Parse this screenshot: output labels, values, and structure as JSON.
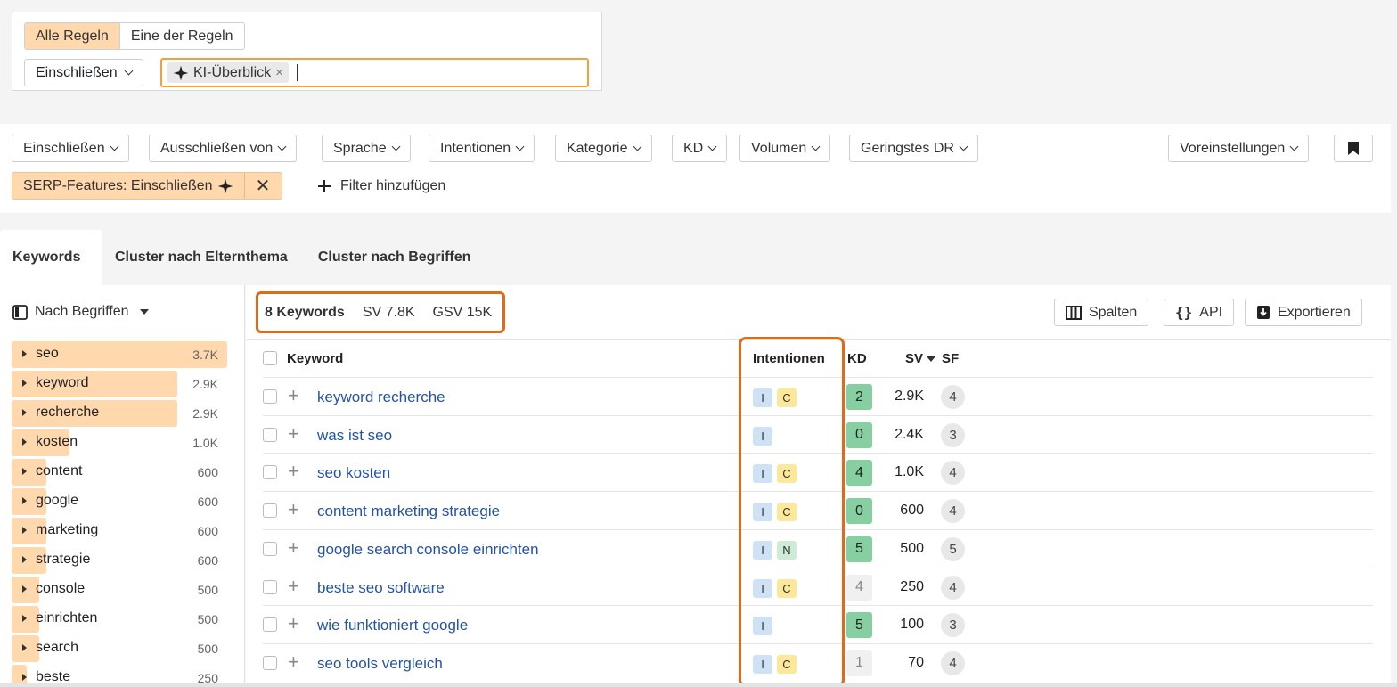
{
  "rule_popover": {
    "mode_all": "Alle Regeln",
    "mode_any": "Eine der Regeln",
    "include_dropdown": "Einschließen",
    "chip_label": "KI-Überblick",
    "chip_close": "×"
  },
  "filters": {
    "buttons": [
      "Einschließen",
      "Ausschließen von",
      "Sprache",
      "Intentionen",
      "Kategorie",
      "KD",
      "Volumen",
      "Geringstes DR"
    ],
    "presets": "Voreinstellungen",
    "bookmark_icon": "bookmark-icon",
    "active_chip": "SERP-Features: Einschließen",
    "active_chip_close": "✕",
    "add_filter": "Filter hinzufügen"
  },
  "tabs": [
    "Keywords",
    "Cluster nach Elternthema",
    "Cluster nach Begriffen"
  ],
  "terms_panel": {
    "header": "Nach Begriffen",
    "items": [
      {
        "name": "seo",
        "count": "3.7K",
        "fill": 1.0
      },
      {
        "name": "keyword",
        "count": "2.9K",
        "fill": 0.77
      },
      {
        "name": "recherche",
        "count": "2.9K",
        "fill": 0.77
      },
      {
        "name": "kosten",
        "count": "1.0K",
        "fill": 0.27
      },
      {
        "name": "content",
        "count": "600",
        "fill": 0.16
      },
      {
        "name": "google",
        "count": "600",
        "fill": 0.16
      },
      {
        "name": "marketing",
        "count": "600",
        "fill": 0.16
      },
      {
        "name": "strategie",
        "count": "600",
        "fill": 0.16
      },
      {
        "name": "console",
        "count": "500",
        "fill": 0.13
      },
      {
        "name": "einrichten",
        "count": "500",
        "fill": 0.13
      },
      {
        "name": "search",
        "count": "500",
        "fill": 0.13
      },
      {
        "name": "beste",
        "count": "250",
        "fill": 0.07
      }
    ]
  },
  "summary": {
    "keywords": "8 Keywords",
    "sv": "SV 7.8K",
    "gsv": "GSV 15K"
  },
  "toolbar": {
    "columns": "Spalten",
    "api": "API",
    "export": "Exportieren"
  },
  "table": {
    "headers": {
      "keyword": "Keyword",
      "intents": "Intentionen",
      "kd": "KD",
      "sv": "SV",
      "sf": "SF"
    },
    "rows": [
      {
        "keyword": "keyword recherche",
        "intents": [
          "I",
          "C"
        ],
        "kd": "2",
        "kd_color": "#86cfa0",
        "sv": "2.9K",
        "sf": "4"
      },
      {
        "keyword": "was ist seo",
        "intents": [
          "I"
        ],
        "kd": "0",
        "kd_color": "#86cfa0",
        "sv": "2.4K",
        "sf": "3"
      },
      {
        "keyword": "seo kosten",
        "intents": [
          "I",
          "C"
        ],
        "kd": "4",
        "kd_color": "#86cfa0",
        "sv": "1.0K",
        "sf": "4"
      },
      {
        "keyword": "content marketing strategie",
        "intents": [
          "I",
          "C"
        ],
        "kd": "0",
        "kd_color": "#86cfa0",
        "sv": "600",
        "sf": "4"
      },
      {
        "keyword": "google search console einrichten",
        "intents": [
          "I",
          "N"
        ],
        "kd": "5",
        "kd_color": "#86cfa0",
        "sv": "500",
        "sf": "5"
      },
      {
        "keyword": "beste seo software",
        "intents": [
          "I",
          "C"
        ],
        "kd": "4",
        "kd_color": "#f0f0f0",
        "sv": "250",
        "sf": "4"
      },
      {
        "keyword": "wie funktioniert google",
        "intents": [
          "I"
        ],
        "kd": "5",
        "kd_color": "#86cfa0",
        "sv": "100",
        "sf": "3"
      },
      {
        "keyword": "seo tools vergleich",
        "intents": [
          "I",
          "C"
        ],
        "kd": "1",
        "kd_color": "#f0f0f0",
        "sv": "70",
        "sf": "4"
      }
    ]
  },
  "colors": {
    "accent": "#ffd8ae",
    "highlight": "#e06a1b",
    "link": "#2453a5"
  }
}
